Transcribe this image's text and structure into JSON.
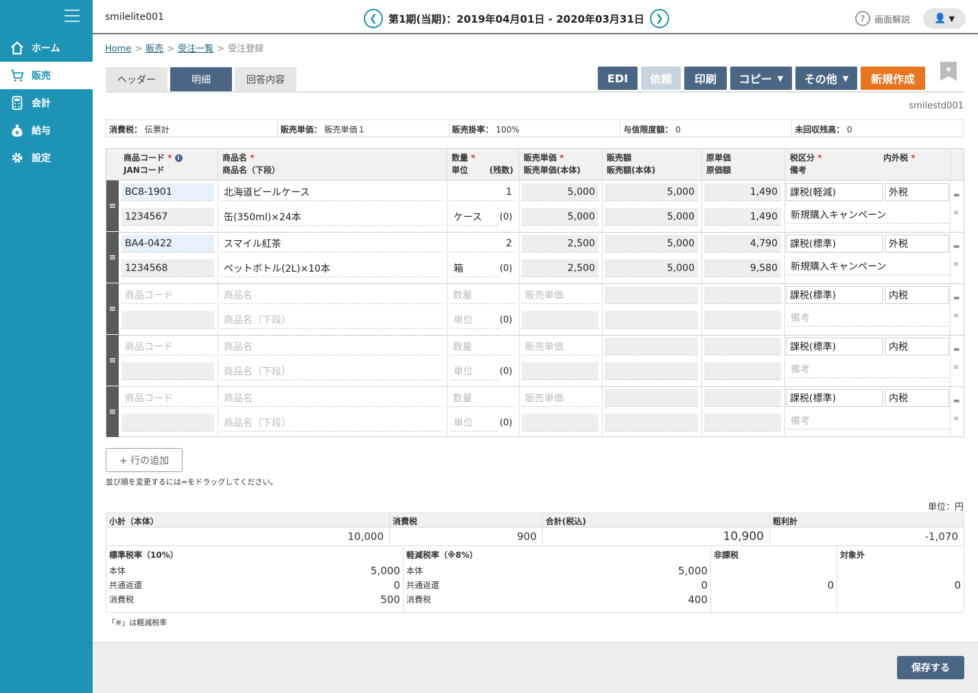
{
  "sidebar": {
    "items": [
      {
        "label": "ホーム",
        "icon": "home-icon"
      },
      {
        "label": "販売",
        "icon": "cart-icon"
      },
      {
        "label": "会計",
        "icon": "calculator-icon"
      },
      {
        "label": "給与",
        "icon": "yen-bag-icon"
      },
      {
        "label": "設定",
        "icon": "gear-icon"
      }
    ]
  },
  "topbar": {
    "company": "smilelite001",
    "period": "第1期(当期)：2019年04月01日 - 2020年03月31日",
    "help_label": "画面解説"
  },
  "breadcrumb": {
    "home": "Home",
    "sales": "販売",
    "order_list": "受注一覧",
    "current": "受注登録"
  },
  "tabs": [
    "ヘッダー",
    "明細",
    "回答内容"
  ],
  "actions": {
    "edi": "EDI",
    "request": "依頼",
    "print": "印刷",
    "copy": "コピー",
    "other": "その他",
    "new": "新規作成"
  },
  "user_id": "smilestd001",
  "info": {
    "tax_label": "消費税：",
    "tax_value": "伝票計",
    "price_label": "販売単価：",
    "price_value": "販売単価１",
    "rate_label": "販売掛率：",
    "rate_value": "100%",
    "credit_label": "与信限度額：",
    "credit_value": "0",
    "unpaid_label": "未回収残高：",
    "unpaid_value": "0"
  },
  "grid_headers": {
    "code": "商品コード",
    "jan": "JANコード",
    "name": "商品名",
    "name2": "商品名（下段）",
    "qty": "数量",
    "unit": "単位",
    "remain": "(残数)",
    "price": "販売単価",
    "price_body": "販売単価(本体)",
    "amount": "販売額",
    "amount_body": "販売額(本体)",
    "cost": "原単価",
    "cost_amount": "原価額",
    "tax_class": "税区分",
    "remarks": "備考",
    "tax_incl": "内外税"
  },
  "rows": [
    {
      "code": "BC8-1901",
      "jan": "1234567",
      "name": "北海道ビールケース",
      "name2": "缶(350ml)×24本",
      "qty": "1",
      "unit": "ケース",
      "remain": "(0)",
      "price": "5,000",
      "price_body": "5,000",
      "amount": "5,000",
      "amount_body": "5,000",
      "cost": "1,490",
      "cost_amount": "1,490",
      "tax_class": "課税(軽減)",
      "tax_incl": "外税",
      "remarks": "新規購入キャンペーン"
    },
    {
      "code": "BA4-0422",
      "jan": "1234568",
      "name": "スマイル紅茶",
      "name2": "ペットボトル(2L)×10本",
      "qty": "2",
      "unit": "箱",
      "remain": "(0)",
      "price": "2,500",
      "price_body": "2,500",
      "amount": "5,000",
      "amount_body": "5,000",
      "cost": "4,790",
      "cost_amount": "9,580",
      "tax_class": "課税(標準)",
      "tax_incl": "外税",
      "remarks": "新規購入キャンペーン"
    }
  ],
  "empty_row": {
    "code_ph": "商品コード",
    "name_ph": "商品名",
    "name2_ph": "商品名（下段）",
    "qty_ph": "数量",
    "unit_ph": "単位",
    "remain": "(0)",
    "price_ph": "販売単価",
    "tax_class": "課税(標準)",
    "tax_incl": "内税",
    "remarks_ph": "備考"
  },
  "add_row": "+ 行の追加",
  "drag_note": "並び順を変更するには=をドラッグしてください。",
  "unit_label": "単位：円",
  "summary": {
    "subtotal_label": "小計（本体）",
    "subtotal": "10,000",
    "tax_label": "消費税",
    "tax": "900",
    "total_label": "合計(税込)",
    "total": "10,900",
    "profit_label": "粗利計",
    "profit": "-1,070",
    "std_label": "標準税率（10%）",
    "reduced_label": "軽減税率（※8%）",
    "nontax_label": "非課税",
    "nontax": "0",
    "exempt_label": "対象外",
    "exempt": "0",
    "body_label": "本体",
    "common_label": "共通返還",
    "ctax_label": "消費税",
    "std_body": "5,000",
    "std_common": "0",
    "std_tax": "500",
    "red_body": "5,000",
    "red_common": "0",
    "red_tax": "400"
  },
  "footnote": "「※」は軽減税率",
  "save": "保存する"
}
